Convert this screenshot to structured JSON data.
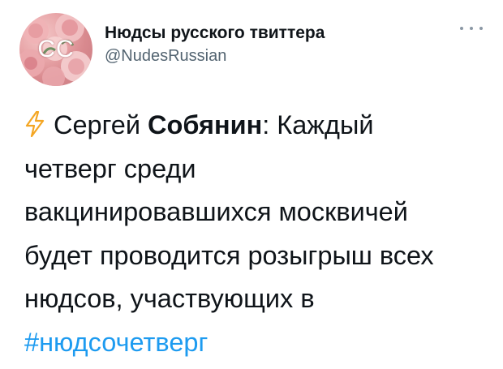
{
  "tweet": {
    "author": {
      "display_name": "Нюдсы русского твиттера",
      "handle": "@NudesRussian",
      "avatar_initials": "CC"
    },
    "more_icon": "more-horizontal-icon",
    "bolt_icon": "lightning-bolt-icon",
    "text": {
      "line1_pre": "Сергей ",
      "line1_bold": "Собянин",
      "line1_post": ": Каждый",
      "line2": "четверг среди",
      "line3": "вакцинировавшихся москвичей",
      "line4": "будет проводится розыгрыш всех",
      "line5": "нюдсов, участвующих в",
      "hashtag": "#нюдсочетверг"
    },
    "colors": {
      "hashtag": "#1d9bf0",
      "handle": "#536471",
      "bolt": "#f4a623"
    }
  }
}
